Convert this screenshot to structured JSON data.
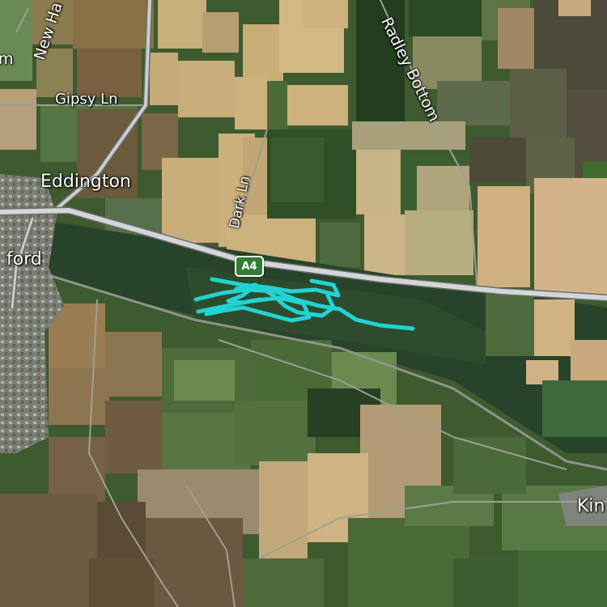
{
  "map": {
    "type": "satellite",
    "labels": {
      "new_ha": "New Ha",
      "m_fragment": "m",
      "gipsy_ln": "Gipsy Ln",
      "radley_bottom": "Radley Bottom",
      "eddington": "Eddington",
      "dark_ln": "Dark Ln",
      "ford": "ford",
      "kin": "Kin"
    },
    "road_shield": "A4",
    "colors": {
      "route": "#22d3d3",
      "road": "#c9ccd0",
      "shield": "#2f7d34"
    }
  }
}
